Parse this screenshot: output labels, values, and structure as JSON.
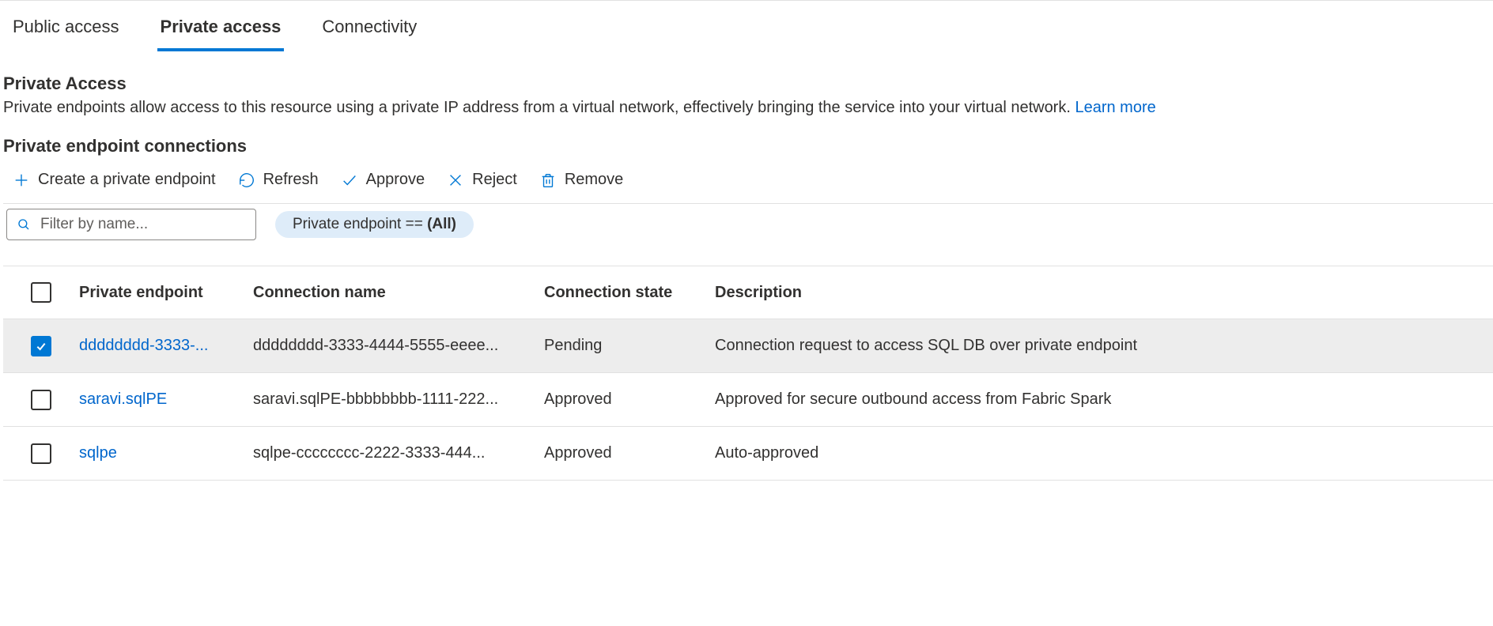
{
  "tabs": [
    {
      "label": "Public access",
      "active": false
    },
    {
      "label": "Private access",
      "active": true
    },
    {
      "label": "Connectivity",
      "active": false
    }
  ],
  "privateAccess": {
    "heading": "Private Access",
    "description": "Private endpoints allow access to this resource using a private IP address from a virtual network, effectively bringing the service into your virtual network. ",
    "learnMore": "Learn more"
  },
  "connections": {
    "heading": "Private endpoint connections",
    "toolbar": {
      "create": "Create a private endpoint",
      "refresh": "Refresh",
      "approve": "Approve",
      "reject": "Reject",
      "remove": "Remove"
    },
    "filter": {
      "placeholder": "Filter by name...",
      "pillPrefix": "Private endpoint == ",
      "pillValue": "(All)"
    },
    "columns": {
      "pe": "Private endpoint",
      "conn": "Connection name",
      "state": "Connection state",
      "desc": "Description"
    },
    "rows": [
      {
        "checked": true,
        "privateEndpoint": "dddddddd-3333-...",
        "connectionName": "dddddddd-3333-4444-5555-eeee...",
        "state": "Pending",
        "description": "Connection request to access SQL DB over private endpoint"
      },
      {
        "checked": false,
        "privateEndpoint": "saravi.sqlPE",
        "connectionName": "saravi.sqlPE-bbbbbbbb-1111-222...",
        "state": "Approved",
        "description": "Approved for secure outbound access from Fabric Spark"
      },
      {
        "checked": false,
        "privateEndpoint": "sqlpe",
        "connectionName": "sqlpe-cccccccc-2222-3333-444...",
        "state": "Approved",
        "description": "Auto-approved"
      }
    ]
  }
}
